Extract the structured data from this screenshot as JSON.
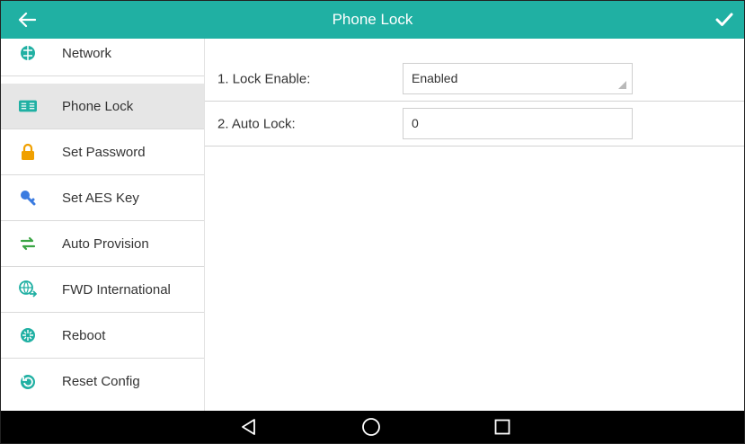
{
  "header": {
    "title": "Phone Lock",
    "back_icon": "arrow-left-icon",
    "confirm_icon": "checkmark-icon",
    "color": "#20b0a3"
  },
  "sidebar": {
    "items": [
      {
        "label": "Network",
        "icon": "network-icon"
      },
      {
        "label": "Phone Lock",
        "icon": "phone-lock-icon",
        "active": true
      },
      {
        "label": "Set Password",
        "icon": "lock-icon"
      },
      {
        "label": "Set AES Key",
        "icon": "key-icon"
      },
      {
        "label": "Auto Provision",
        "icon": "sync-icon"
      },
      {
        "label": "FWD International",
        "icon": "globe-forward-icon"
      },
      {
        "label": "Reboot",
        "icon": "reboot-icon"
      },
      {
        "label": "Reset Config",
        "icon": "reset-icon"
      }
    ]
  },
  "form": {
    "lock_enable": {
      "label": "1. Lock Enable:",
      "value": "Enabled"
    },
    "auto_lock": {
      "label": "2. Auto Lock:",
      "value": "0"
    }
  },
  "navbar": {
    "back": "nav-back-icon",
    "home": "nav-home-icon",
    "recents": "nav-recents-icon"
  }
}
